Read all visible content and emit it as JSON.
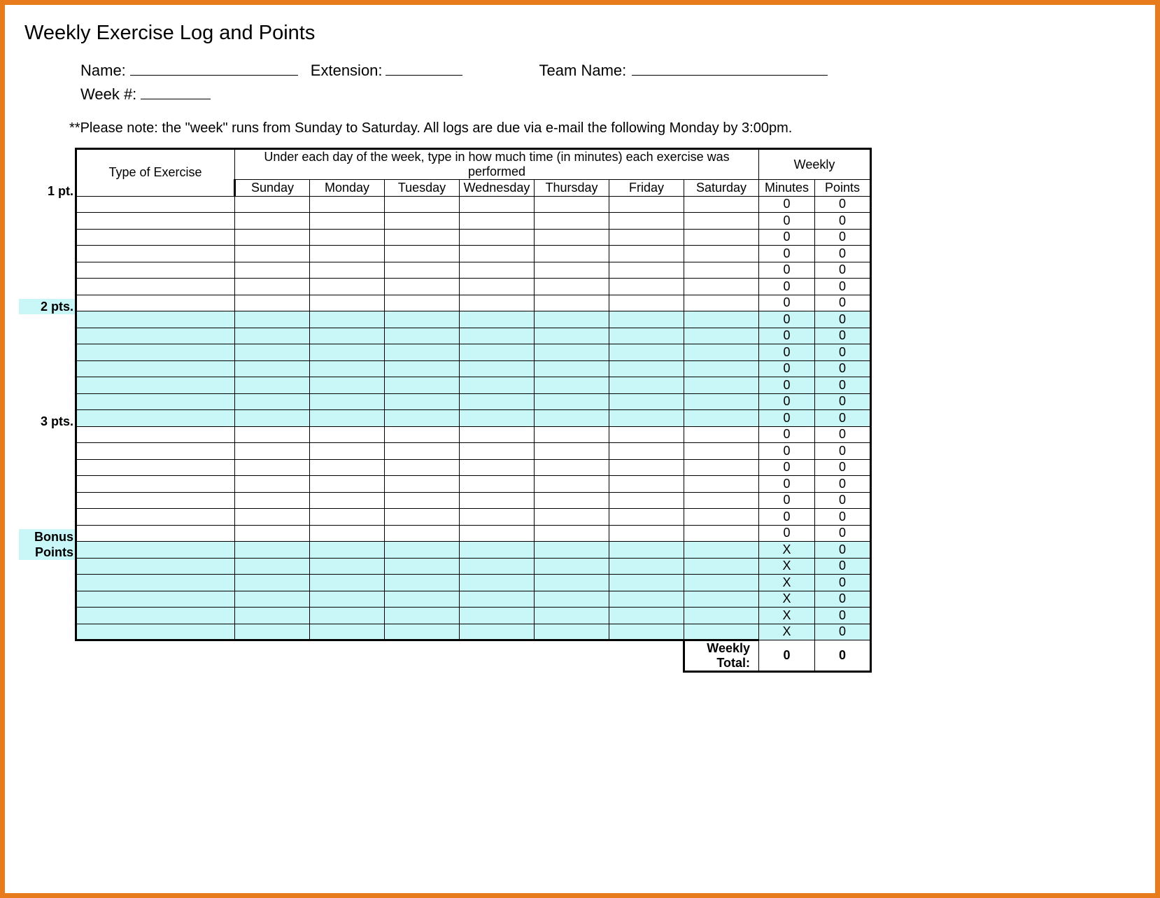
{
  "title": "Weekly Exercise Log and Points",
  "fields": {
    "name_label": "Name:",
    "extension_label": "Extension:",
    "team_label": "Team Name:",
    "week_label": "Week #:"
  },
  "note": "**Please note: the \"week\" runs from Sunday to Saturday.  All logs are due via e-mail the following Monday by 3:00pm.",
  "headers": {
    "type": "Type of Exercise",
    "instruction": "Under each day of the week, type in how much time (in minutes) each exercise was performed",
    "weekly": "Weekly",
    "days": [
      "Sunday",
      "Monday",
      "Tuesday",
      "Wednesday",
      "Thursday",
      "Friday",
      "Saturday"
    ],
    "minutes": "Minutes",
    "points": "Points"
  },
  "side_labels": {
    "pt1": "1 pt.",
    "pt2": "2 pts.",
    "pt3": "3 pts.",
    "bonus": "Bonus\nPoints"
  },
  "groups": [
    {
      "label_key": "pt1",
      "highlight": false,
      "rows": 7
    },
    {
      "label_key": "pt2",
      "highlight": true,
      "rows": 7
    },
    {
      "label_key": "pt3",
      "highlight": false,
      "rows": 7
    },
    {
      "label_key": "bonus",
      "highlight": true,
      "rows": 6,
      "minutes_override": "X"
    }
  ],
  "defaults": {
    "minutes": "0",
    "points": "0"
  },
  "totals": {
    "label": "Weekly Total:",
    "minutes": "0",
    "points": "0"
  }
}
